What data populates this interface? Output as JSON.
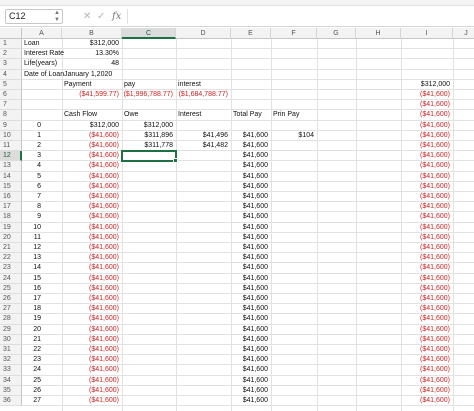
{
  "formula_bar": {
    "name_box": "C12",
    "cancel_icon": "✕",
    "confirm_icon": "✓",
    "fx_label": "fx",
    "formula": ""
  },
  "columns": [
    "A",
    "B",
    "C",
    "D",
    "E",
    "F",
    "G",
    "H",
    "I",
    "J"
  ],
  "selected_cell": {
    "col": "C",
    "row": 12
  },
  "colors": {
    "negative": "#cc2222",
    "selection": "#1e7145"
  },
  "row_numbers": [
    1,
    2,
    3,
    4,
    5,
    6,
    7,
    8,
    9,
    10,
    11,
    12,
    13,
    14,
    15,
    16,
    17,
    18,
    19,
    20,
    21,
    22,
    23,
    24,
    25,
    26,
    27,
    28,
    29,
    30,
    31,
    32,
    33,
    34,
    35,
    36
  ],
  "rows": {
    "1": {
      "A": "Loan",
      "B": "$312,000"
    },
    "2": {
      "A": "Interest Rate",
      "B": "13.30%"
    },
    "3": {
      "A": "Life(years)",
      "B": "48"
    },
    "4": {
      "A": "Date of Loan",
      "B": "January 1,2020"
    },
    "5": {
      "B": "Payment",
      "C": "pay",
      "D": "interest",
      "I": "$312,000"
    },
    "6": {
      "B": "($41,599.77)",
      "C": "($1,996,788.77)",
      "D": "($1,684,788.77)",
      "I": "($41,600)"
    },
    "7": {
      "I": "($41,600)"
    },
    "8": {
      "B": "Cash Flow",
      "C": "Owe",
      "D": "Interest",
      "E": "Total Pay",
      "F": "Prin Pay",
      "I": "($41,600)"
    },
    "9": {
      "A": "0",
      "B": "$312,000",
      "C": "$312,000",
      "I": "($41,600)"
    },
    "10": {
      "A": "1",
      "B": "($41,600)",
      "C": "$311,896",
      "D": "$41,496",
      "E": "$41,600",
      "F": "$104",
      "I": "($41,600)"
    },
    "11": {
      "A": "2",
      "B": "($41,600)",
      "C": "$311,778",
      "D": "$41,482",
      "E": "$41,600",
      "I": "($41,600)"
    },
    "12": {
      "A": "3",
      "B": "($41,600)",
      "E": "$41,600",
      "I": "($41,600)"
    },
    "13": {
      "A": "4",
      "B": "($41,600)",
      "E": "$41,600",
      "I": "($41,600)"
    },
    "14": {
      "A": "5",
      "B": "($41,600)",
      "E": "$41,600",
      "I": "($41,600)"
    },
    "15": {
      "A": "6",
      "B": "($41,600)",
      "E": "$41,600",
      "I": "($41,600)"
    },
    "16": {
      "A": "7",
      "B": "($41,600)",
      "E": "$41,600",
      "I": "($41,600)"
    },
    "17": {
      "A": "8",
      "B": "($41,600)",
      "E": "$41,600",
      "I": "($41,600)"
    },
    "18": {
      "A": "9",
      "B": "($41,600)",
      "E": "$41,600",
      "I": "($41,600)"
    },
    "19": {
      "A": "10",
      "B": "($41,600)",
      "E": "$41,600",
      "I": "($41,600)"
    },
    "20": {
      "A": "11",
      "B": "($41,600)",
      "E": "$41,600",
      "I": "($41,600)"
    },
    "21": {
      "A": "12",
      "B": "($41,600)",
      "E": "$41,600",
      "I": "($41,600)"
    },
    "22": {
      "A": "13",
      "B": "($41,600)",
      "E": "$41,600",
      "I": "($41,600)"
    },
    "23": {
      "A": "14",
      "B": "($41,600)",
      "E": "$41,600",
      "I": "($41,600)"
    },
    "24": {
      "A": "15",
      "B": "($41,600)",
      "E": "$41,600",
      "I": "($41,600)"
    },
    "25": {
      "A": "16",
      "B": "($41,600)",
      "E": "$41,600",
      "I": "($41,600)"
    },
    "26": {
      "A": "17",
      "B": "($41,600)",
      "E": "$41,600",
      "I": "($41,600)"
    },
    "27": {
      "A": "18",
      "B": "($41,600)",
      "E": "$41,600",
      "I": "($41,600)"
    },
    "28": {
      "A": "19",
      "B": "($41,600)",
      "E": "$41,600",
      "I": "($41,600)"
    },
    "29": {
      "A": "20",
      "B": "($41,600)",
      "E": "$41,600",
      "I": "($41,600)"
    },
    "30": {
      "A": "21",
      "B": "($41,600)",
      "E": "$41,600",
      "I": "($41,600)"
    },
    "31": {
      "A": "22",
      "B": "($41,600)",
      "E": "$41,600",
      "I": "($41,600)"
    },
    "32": {
      "A": "23",
      "B": "($41,600)",
      "E": "$41,600",
      "I": "($41,600)"
    },
    "33": {
      "A": "24",
      "B": "($41,600)",
      "E": "$41,600",
      "I": "($41,600)"
    },
    "34": {
      "A": "25",
      "B": "($41,600)",
      "E": "$41,600",
      "I": "($41,600)"
    },
    "35": {
      "A": "26",
      "B": "($41,600)",
      "E": "$41,600",
      "I": "($41,600)"
    },
    "36": {
      "A": "27",
      "B": "($41,600)",
      "E": "$41,600",
      "I": "($41,600)"
    }
  }
}
